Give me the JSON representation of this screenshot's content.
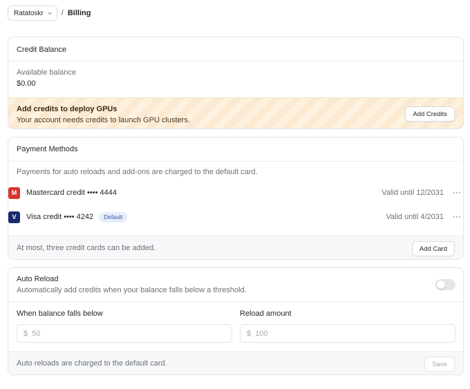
{
  "breadcrumb": {
    "org": "Ratatoskr",
    "separator": "/",
    "page": "Billing"
  },
  "credit_balance": {
    "title": "Credit Balance",
    "available_label": "Available balance",
    "available_value": "$0.00",
    "alert": {
      "title": "Add credits to deploy GPUs",
      "message": "Your account needs credits to launch GPU clusters.",
      "button": "Add Credits"
    }
  },
  "payment_methods": {
    "title": "Payment Methods",
    "description": "Payments for auto reloads and add-ons are charged to the default card.",
    "cards": [
      {
        "logo_letter": "M",
        "logo_color": "#d8342f",
        "name": "Mastercard credit •••• 4444",
        "badge": "",
        "valid": "Valid until 12/2031",
        "menu": "···"
      },
      {
        "logo_letter": "V",
        "logo_color": "#1a2a6c",
        "name": "Visa credit •••• 4242",
        "badge": "Default",
        "valid": "Valid until 4/2031",
        "menu": "···"
      }
    ],
    "footer_note": "At most, three credit cards can be added.",
    "add_button": "Add Card"
  },
  "auto_reload": {
    "title": "Auto Reload",
    "subtitle": "Automatically add credits when your balance falls below a threshold.",
    "enabled": false,
    "threshold": {
      "label": "When balance falls below",
      "currency": "$",
      "placeholder": "50",
      "value": ""
    },
    "amount": {
      "label": "Reload amount",
      "currency": "$",
      "placeholder": "100",
      "value": ""
    },
    "footer_note": "Auto reloads are charged to the default card.",
    "save_button": "Save"
  }
}
